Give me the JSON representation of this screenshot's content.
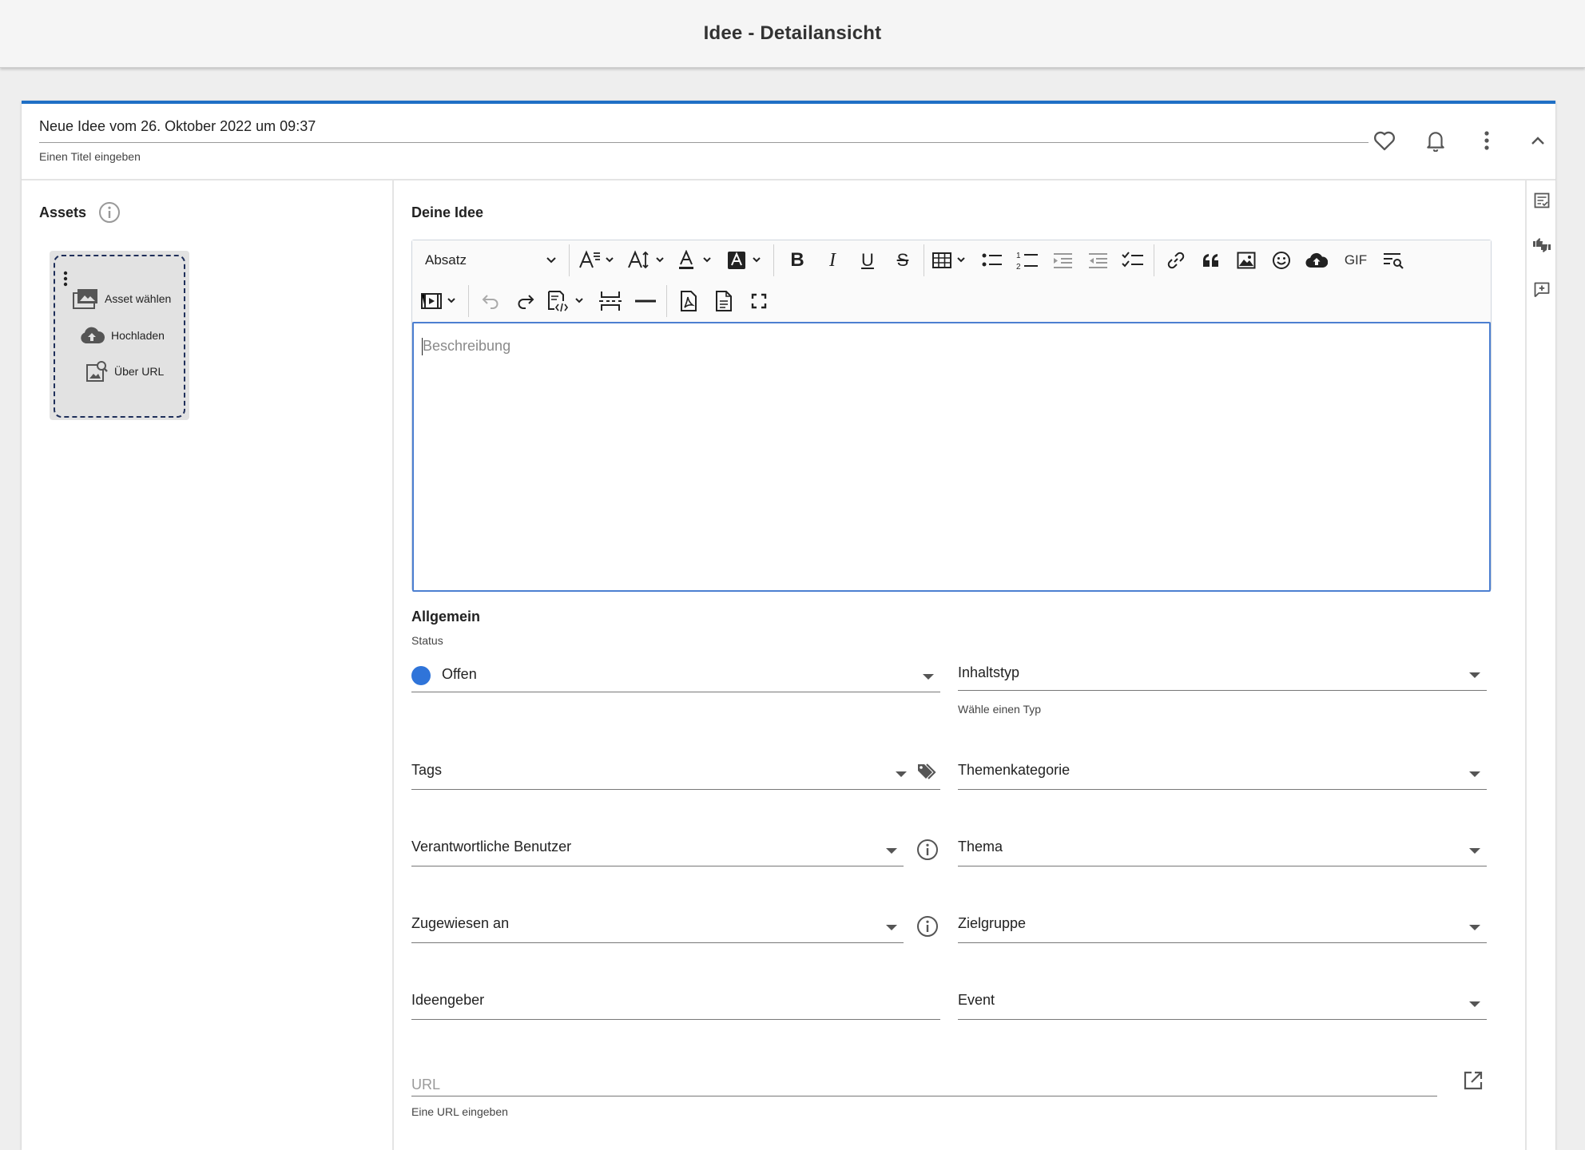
{
  "page": {
    "title": "Idee - Detailansicht"
  },
  "header": {
    "title_value": "Neue Idee vom 26. Oktober 2022 um 09:37",
    "title_hint": "Einen Titel eingeben",
    "icons": [
      "heart-icon",
      "bell-icon",
      "more-vert-icon",
      "chevron-up-icon"
    ]
  },
  "assets": {
    "label": "Assets",
    "actions": {
      "choose": "Asset wählen",
      "upload": "Hochladen",
      "url": "Über URL"
    }
  },
  "editor": {
    "section_label": "Deine Idee",
    "paragraph_select": "Absatz",
    "gif_label": "GIF",
    "placeholder": "Beschreibung"
  },
  "general": {
    "section_label": "Allgemein",
    "status": {
      "label": "Status",
      "value": "Offen",
      "color": "#2f74d9"
    },
    "fields": {
      "content_type": "Inhaltstyp",
      "content_type_hint": "Wähle einen Typ",
      "tags": "Tags",
      "topic_category": "Themenkategorie",
      "responsible_users": "Verantwortliche Benutzer",
      "topic": "Thema",
      "assigned_to": "Zugewiesen an",
      "target_group": "Zielgruppe",
      "idea_giver": "Ideengeber",
      "event": "Event",
      "url_placeholder": "URL",
      "url_hint": "Eine URL eingeben"
    }
  },
  "colors": {
    "accent": "#1f6fc5",
    "focus": "#4c7fd1"
  }
}
